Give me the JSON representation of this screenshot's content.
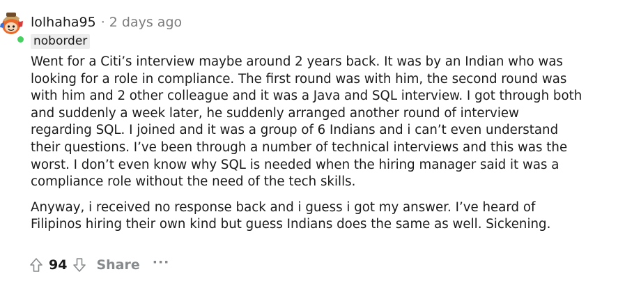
{
  "comment": {
    "author": "lolhaha95",
    "separator": "·",
    "timestamp": "2 days ago",
    "flair": "noborder",
    "avatar_icon": "snoo-avatar-icon",
    "online_color": "#46d160",
    "paragraphs": [
      {
        "lines": [
          "Went for a Citi’s interview maybe around 2 years back. It was by an Indian who was",
          "looking for a role in compliance. The first round was with him, the second round was",
          "with him and 2 other colleague and it was a Java and SQL interview. I got through both",
          "and suddenly a week later, he suddenly arranged another round of interview",
          "regarding SQL. I joined and it was a group of 6 Indians and i can’t even understand",
          "their questions. I’ve been through a number of technical interviews and this was the",
          "worst. I don’t even know why SQL is needed when the hiring manager said it was a",
          "compliance role without the need of the tech skills."
        ]
      },
      {
        "lines": [
          "Anyway, i received no response back and i guess i got my answer. I’ve heard of",
          "Filipinos hiring their own kind but guess Indians does the same as well. Sickening."
        ]
      }
    ],
    "actions": {
      "upvote_icon": "upvote-arrow-icon",
      "score": "94",
      "downvote_icon": "downvote-arrow-icon",
      "share_label": "Share",
      "more_label": "···"
    }
  }
}
